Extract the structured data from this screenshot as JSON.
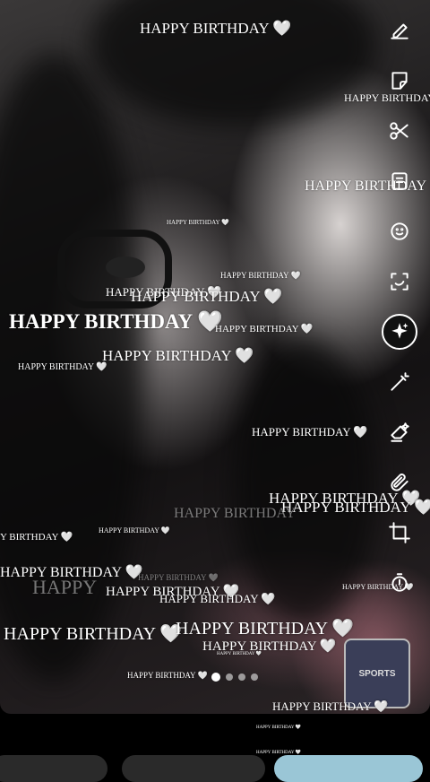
{
  "overlay_text": "HAPPY BIRTHDAY 🤍",
  "stamps": [
    {
      "t": "HAPPY BIRTHDAY 🤍"
    },
    {
      "t": "HAPPY BIRTHDAY"
    },
    {
      "t": "HAPPY BIRTHDAY"
    },
    {
      "t": "HAPPY BIRTHDAY 🤍"
    },
    {
      "t": "HAPPY BIRTHDAY 🤍"
    },
    {
      "t": "HAPPY BIRTHDAY 🤍"
    },
    {
      "t": "HAPPY BIRTHDAY 🤍"
    },
    {
      "t": "HAPPY BIRTHDAY 🤍"
    },
    {
      "t": "HAPPY BIRTHDAY 🤍"
    },
    {
      "t": "HAPPY BIRTHDAY 🤍"
    },
    {
      "t": "HAPPY BIRTHDAY 🤍"
    },
    {
      "t": "HAPPY BIRTHDAY 🤍"
    },
    {
      "t": "HAPPY BIRTHDAY 🤍"
    },
    {
      "t": "HAPPY BIRTHDAY 🤍"
    },
    {
      "t": "HAPPY BIRTHDAY"
    },
    {
      "t": "HAPPY BIRTHDAY 🤍"
    },
    {
      "t": "Y BIRTHDAY 🤍"
    },
    {
      "t": "HAPPY BIRTHDAY 🤍"
    },
    {
      "t": "HAPPY BIRTHDAY 🤍"
    },
    {
      "t": "HAPPY BIRTHDAY 🤍"
    },
    {
      "t": "HAPPY BIRTHDAY 🤍"
    },
    {
      "t": "HAPPY BIRTHDAY 🤍"
    },
    {
      "t": "HAPPY BIRTHDAY 🤍"
    },
    {
      "t": "HAPPY BIRTHDAY 🤍"
    },
    {
      "t": "HAPPY BIRTHDAY 🤍"
    },
    {
      "t": "HAPPY BIRTHDAY 🤍"
    },
    {
      "t": "HAPPY BIRTHDAY 🤍"
    },
    {
      "t": "HAPPY BIRTHDAY 🤍"
    },
    {
      "t": "HAPPY BIRTHDAY 🤍"
    },
    {
      "t": "HAPPY BIRTHDAY 🤍"
    },
    {
      "t": "HAPPY BIRTHDAY 🤍"
    },
    {
      "t": "HAPPY BIRTHDAY 🤍"
    },
    {
      "t": "HAPPY BIRTHDAY 🤍"
    },
    {
      "t": "HAPPY"
    }
  ],
  "toolbar": {
    "tools": [
      "draw-icon",
      "sticker-icon",
      "scissors-icon",
      "music-icon",
      "emoji-effect-icon",
      "scan-icon",
      "ai-sparkle-icon",
      "magic-wand-icon",
      "eraser-icon",
      "attachment-icon",
      "crop-icon",
      "timer-icon"
    ],
    "active": "ai-sparkle-icon"
  },
  "shirt_text": "SPORTS"
}
